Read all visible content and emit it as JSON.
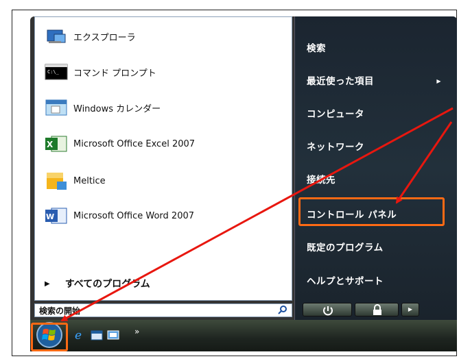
{
  "start_menu": {
    "programs": [
      {
        "label": "エクスプローラ",
        "icon": "explorer-icon"
      },
      {
        "label": "コマンド プロンプト",
        "icon": "command-prompt-icon"
      },
      {
        "label": "Windows カレンダー",
        "icon": "calendar-icon"
      },
      {
        "label": "Microsoft Office Excel 2007",
        "icon": "excel-icon"
      },
      {
        "label": "Meltice",
        "icon": "meltice-icon"
      },
      {
        "label": "Microsoft Office Word 2007",
        "icon": "word-icon"
      }
    ],
    "all_programs_label": "すべてのプログラム",
    "search_placeholder": "検索の開始",
    "right_items": [
      {
        "label": "検索"
      },
      {
        "label": "最近使った項目"
      },
      {
        "label": "コンピュータ"
      },
      {
        "label": "ネットワーク"
      },
      {
        "label": "接続先"
      },
      {
        "label": "コントロール パネル"
      },
      {
        "label": "既定のプログラム"
      },
      {
        "label": "ヘルプとサポート"
      }
    ]
  },
  "taskbar": {
    "overflow_label": "»"
  },
  "colors": {
    "highlight": "#ff6a14",
    "arrow": "#e8170f",
    "right_panel": "#1b2530"
  }
}
